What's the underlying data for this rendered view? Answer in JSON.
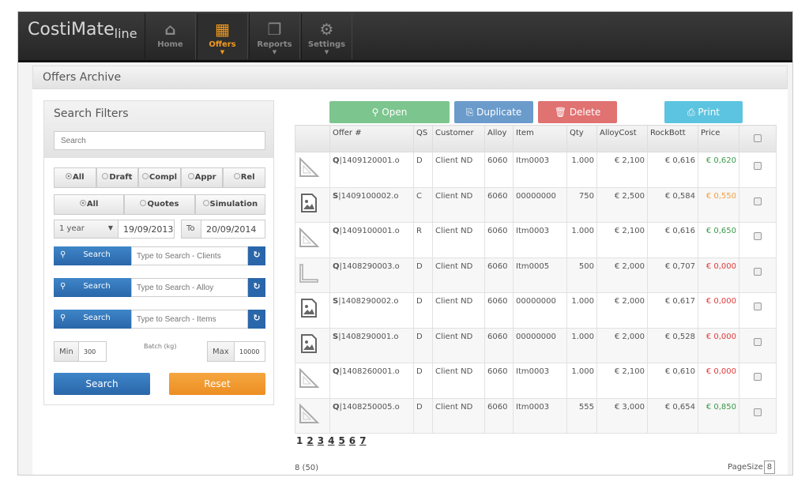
{
  "app": {
    "name": "CostiMate",
    "suffix": "line"
  },
  "nav": [
    {
      "label": "Home",
      "icon": "home-icon",
      "glyph": "⌂"
    },
    {
      "label": "Offers",
      "icon": "grid-icon",
      "glyph": "▦",
      "active": true
    },
    {
      "label": "Reports",
      "icon": "copy-icon",
      "glyph": "❐"
    },
    {
      "label": "Settings",
      "icon": "gear-icon",
      "glyph": "⚙"
    }
  ],
  "page_title": "Offers Archive",
  "filters": {
    "title": "Search Filters",
    "search_placeholder": "Search",
    "status": [
      "All",
      "Draft",
      "Compl",
      "Appr",
      "Rel"
    ],
    "type": [
      "All",
      "Quotes",
      "Simulation"
    ],
    "period": "1 year",
    "from": "19/09/2013",
    "to_label": "To",
    "to": "20/09/2014",
    "search_label": "Search",
    "clients_placeholder": "Type to Search - Clients",
    "alloy_placeholder": "Type to Search - Alloy",
    "items_placeholder": "Type to Search - Items",
    "min_label": "Min",
    "min": "300",
    "batch_label": "Batch (kg)",
    "max_label": "Max",
    "max": "10000",
    "search_button": "Search",
    "reset_button": "Reset"
  },
  "actions": {
    "open": "Open",
    "duplicate": "Duplicate",
    "delete": "Delete",
    "print": "Print"
  },
  "colors": {
    "open": "#7dc58f",
    "duplicate": "#6a9bcb",
    "delete": "#e07272",
    "print": "#5cc4e0",
    "search": "#2f72b8",
    "reset": "#f29a30",
    "price_green": "#3a9a4a",
    "price_orange": "#f0a040",
    "price_red": "#e03b3b"
  },
  "table": {
    "headers": [
      "Offer #",
      "QS",
      "Customer",
      "Alloy",
      "Item",
      "Qty",
      "AlloyCost",
      "RockBott",
      "Price"
    ],
    "rows": [
      {
        "icon": "triangle-icon",
        "prefix": "Q",
        "offer": "|1409120001.o",
        "qs": "D",
        "customer": "Client ND",
        "alloy": "6060",
        "item": "Itm0003",
        "qty": "1.000",
        "alloycost": "€ 2,100",
        "rockbott": "€ 0,616",
        "price": "€ 0,620",
        "status": "green"
      },
      {
        "icon": "image-file-icon",
        "prefix": "S",
        "offer": "|1409100002.o",
        "qs": "C",
        "customer": "Client ND",
        "alloy": "6060",
        "item": "00000000",
        "qty": "750",
        "alloycost": "€ 2,500",
        "rockbott": "€ 0,584",
        "price": "€ 0,550",
        "status": "orange"
      },
      {
        "icon": "triangle-icon",
        "prefix": "Q",
        "offer": "|1409100001.o",
        "qs": "R",
        "customer": "Client ND",
        "alloy": "6060",
        "item": "Itm0003",
        "qty": "1.000",
        "alloycost": "€ 2,100",
        "rockbott": "€ 0,616",
        "price": "€ 0,650",
        "status": "green"
      },
      {
        "icon": "angle-profile-icon",
        "prefix": "Q",
        "offer": "|1408290003.o",
        "qs": "D",
        "customer": "Client ND",
        "alloy": "6060",
        "item": "Itm0005",
        "qty": "500",
        "alloycost": "€ 2,000",
        "rockbott": "€ 0,707",
        "price": "€ 0,000",
        "status": "red"
      },
      {
        "icon": "image-file-icon",
        "prefix": "S",
        "offer": "|1408290002.o",
        "qs": "D",
        "customer": "Client ND",
        "alloy": "6060",
        "item": "00000000",
        "qty": "1.000",
        "alloycost": "€ 2,000",
        "rockbott": "€ 0,617",
        "price": "€ 0,000",
        "status": "red"
      },
      {
        "icon": "image-file-icon",
        "prefix": "S",
        "offer": "|1408290001.o",
        "qs": "D",
        "customer": "Client ND",
        "alloy": "6060",
        "item": "00000000",
        "qty": "1.000",
        "alloycost": "€ 2,000",
        "rockbott": "€ 0,528",
        "price": "€ 0,000",
        "status": "red"
      },
      {
        "icon": "triangle-icon",
        "prefix": "Q",
        "offer": "|1408260001.o",
        "qs": "D",
        "customer": "Client ND",
        "alloy": "6060",
        "item": "Itm0003",
        "qty": "1.000",
        "alloycost": "€ 2,100",
        "rockbott": "€ 0,610",
        "price": "€ 0,000",
        "status": "red"
      },
      {
        "icon": "triangle-icon",
        "prefix": "Q",
        "offer": "|1408250005.o",
        "qs": "D",
        "customer": "Client ND",
        "alloy": "6060",
        "item": "Itm0003",
        "qty": "555",
        "alloycost": "€ 3,000",
        "rockbott": "€ 0,654",
        "price": "€ 0,850",
        "status": "green"
      }
    ]
  },
  "pagination": {
    "pages": [
      "1",
      "2",
      "3",
      "4",
      "5",
      "6",
      "7"
    ],
    "current": "1"
  },
  "footer": {
    "count": "8 (50)",
    "pagesize_label": "PageSize",
    "pagesize": "8"
  }
}
